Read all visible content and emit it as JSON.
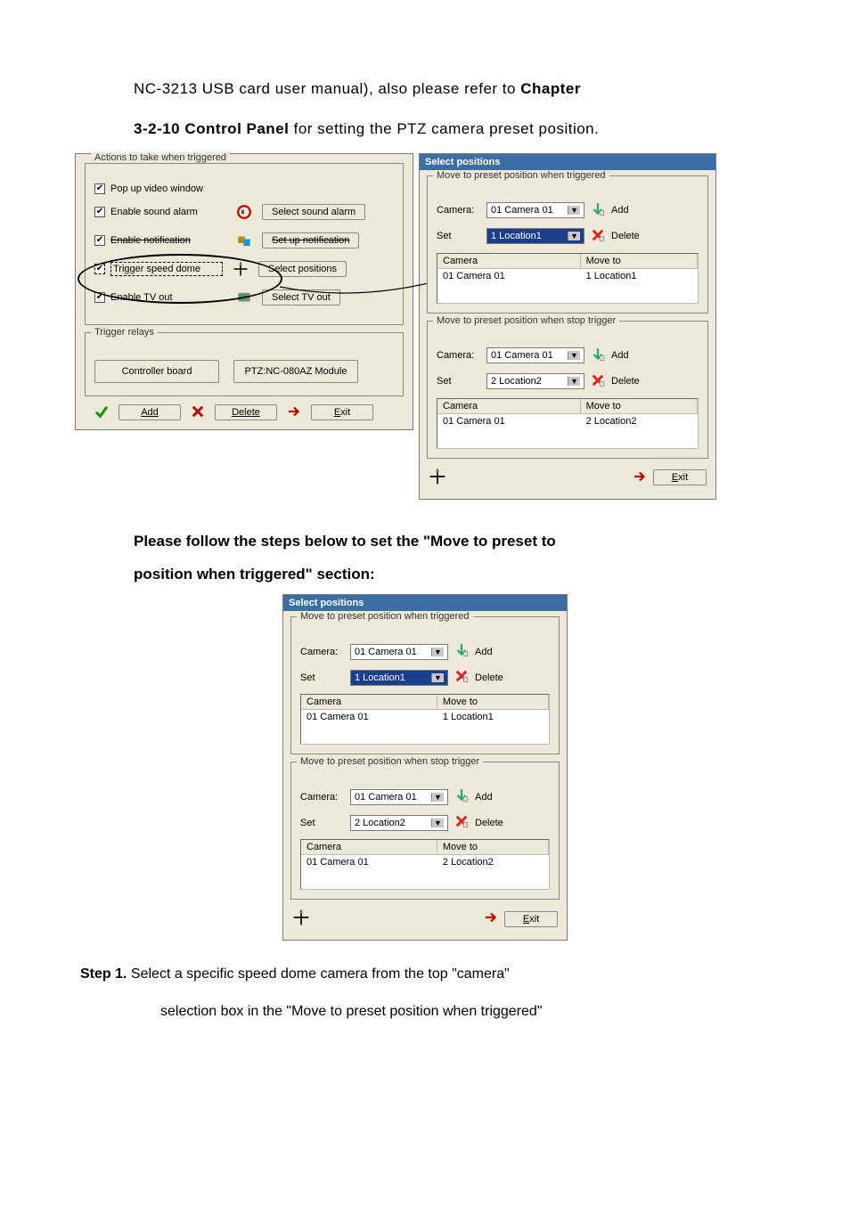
{
  "intro": {
    "line1_prefix": "NC-3213 USB card user manual), also please refer to ",
    "chapter": "Chapter",
    "line2_prefix": "3-2-10 Control Panel",
    "line2_suffix": " for setting the PTZ camera preset position."
  },
  "left_dialog": {
    "group_title": "Actions to take when triggered",
    "popup": "Pop up video window",
    "sound_alarm": "Enable sound alarm",
    "sound_btn": "Select sound alarm",
    "notification": "Enable notification",
    "notif_btn": "Set up notification",
    "trigger_dome": "Trigger speed dome",
    "positions_btn": "Select positions",
    "tv_out": "Enable TV out",
    "tv_btn": "Select TV out",
    "relays_title": "Trigger relays",
    "relay_a": "Controller board",
    "relay_b": "PTZ:NC-080AZ Module",
    "add": "Add",
    "delete": "Delete",
    "exit": "Exit"
  },
  "right_dialog": {
    "title": "Select positions",
    "group1": "Move to preset position when triggered",
    "group2": "Move to preset position when stop trigger",
    "camera_label": "Camera:",
    "set_label": "Set",
    "camera_value": "01 Camera 01",
    "set_value1": "1 Location1",
    "set_value2": "2 Location2",
    "add": "Add",
    "delete": "Delete",
    "col_camera": "Camera",
    "col_moveto": "Move to",
    "row1_cam": "01 Camera 01",
    "row1_loc": "1 Location1",
    "row2_cam": "01 Camera 01",
    "row2_loc": "2 Location2",
    "exit": "Exit"
  },
  "para2": {
    "line1": "Please follow the steps below to set the \"Move to preset to",
    "line2": "position when triggered\" section:"
  },
  "step1": {
    "label": "Step 1.",
    "text1": "  Select a specific speed dome camera from the top \"camera\"",
    "text2": "selection box in the \"Move to preset position when triggered\""
  }
}
